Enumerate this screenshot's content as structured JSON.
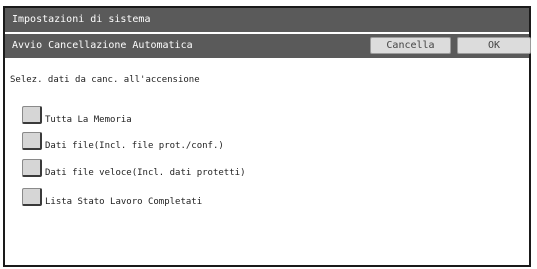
{
  "window": {
    "title": "Impostazioni di sistema"
  },
  "header": {
    "title": "Avvio Cancellazione Automatica",
    "cancel_label": "Cancella",
    "ok_label": "OK"
  },
  "main": {
    "instruction": "Selez. dati da canc. all'accensione",
    "options": [
      {
        "label": "Tutta La Memoria",
        "checked": false
      },
      {
        "label": "Dati file(Incl. file prot./conf.)",
        "checked": false
      },
      {
        "label": "Dati file veloce(Incl. dati protetti)",
        "checked": false
      },
      {
        "label": "Lista Stato Lavoro Completati",
        "checked": false
      }
    ]
  },
  "colors": {
    "bar": "#5a5a5a",
    "button": "#dcdcdc",
    "checkbox": "#d6d6d6"
  }
}
